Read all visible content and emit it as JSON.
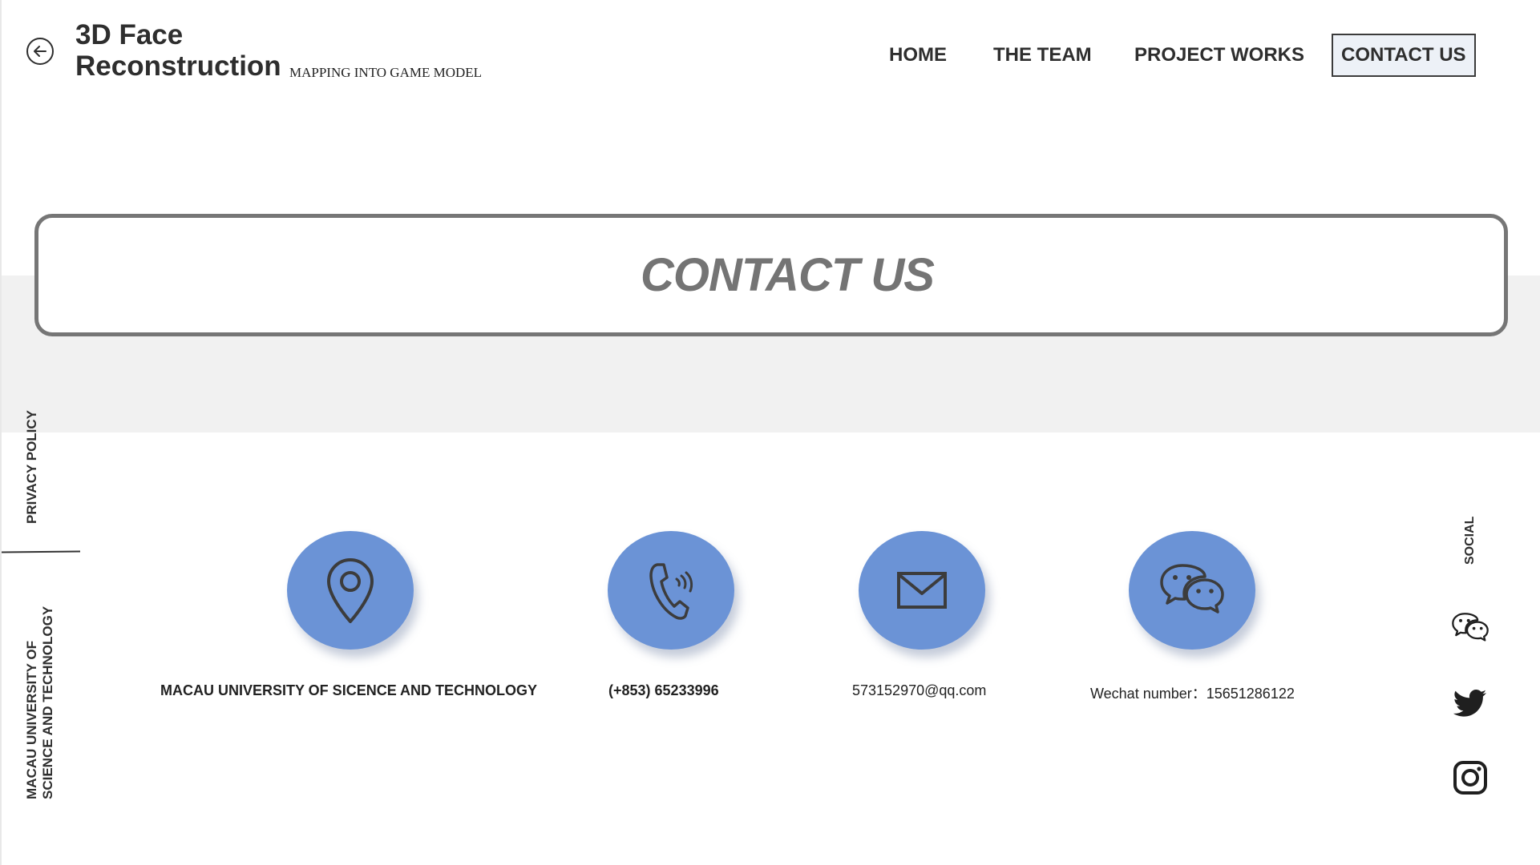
{
  "header": {
    "title_line1": "3D Face",
    "title_line2": "Reconstruction",
    "subtitle": "MAPPING INTO GAME MODEL"
  },
  "nav": {
    "items": [
      {
        "label": "HOME"
      },
      {
        "label": "THE TEAM"
      },
      {
        "label": "PROJECT WORKS"
      },
      {
        "label": "CONTACT US",
        "active": true
      }
    ]
  },
  "banner": {
    "title": "CONTACT US"
  },
  "sidebar": {
    "privacy": "PRIVACY POLICY",
    "university_line1": "MACAU UNIVERSITY OF",
    "university_line2": "SCIENCE AND TECHNOLOGY"
  },
  "contacts": [
    {
      "icon": "location-pin-icon",
      "label": "MACAU UNIVERSITY OF SICENCE AND TECHNOLOGY"
    },
    {
      "icon": "phone-icon",
      "label": "(+853) 65233996"
    },
    {
      "icon": "mail-icon",
      "label": "573152970@qq.com"
    },
    {
      "icon": "wechat-icon",
      "label": "Wechat number：15651286122"
    }
  ],
  "social": {
    "label": "SOCIAL",
    "icons": [
      "wechat-icon",
      "twitter-icon",
      "instagram-icon"
    ]
  },
  "colors": {
    "circle": "#6b93d6",
    "band": "#f1f1f1",
    "banner_border": "#767676",
    "active_nav_bg": "#edf1f7"
  }
}
